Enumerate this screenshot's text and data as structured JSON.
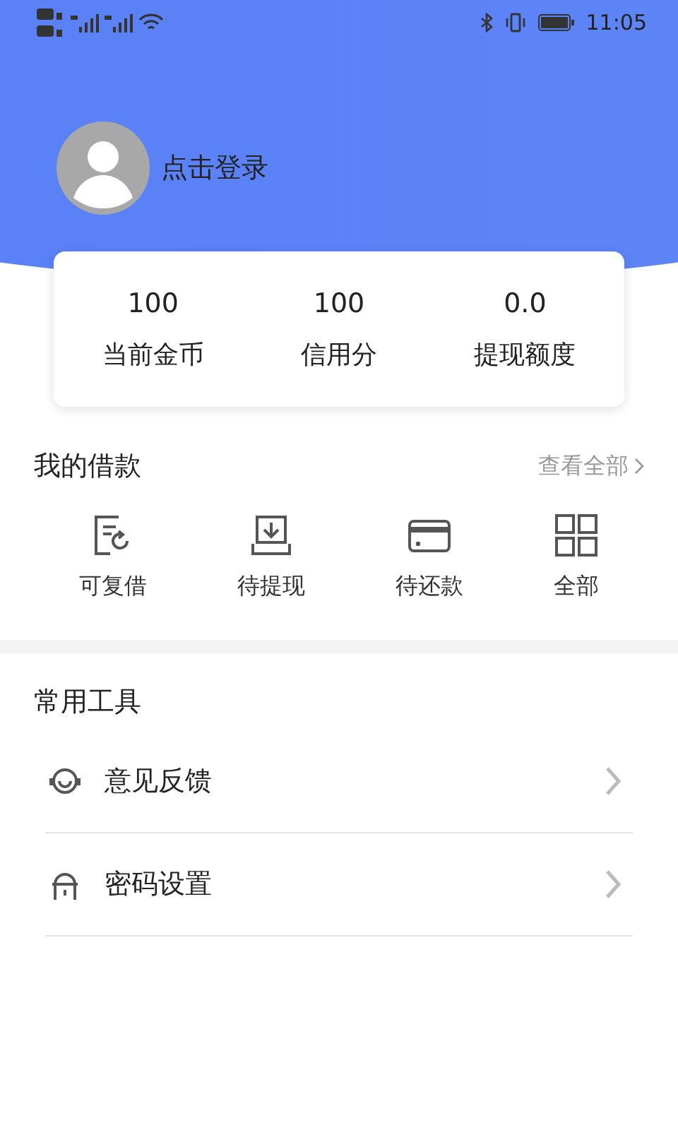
{
  "status_bar": {
    "time": "11:05"
  },
  "profile": {
    "login_label": "点击登录"
  },
  "stats": [
    {
      "value": "100",
      "label": "当前金币"
    },
    {
      "value": "100",
      "label": "信用分"
    },
    {
      "value": "0.0",
      "label": "提现额度"
    }
  ],
  "loans": {
    "title": "我的借款",
    "view_all": "查看全部",
    "items": [
      {
        "kind": "reborrow",
        "label": "可复借"
      },
      {
        "kind": "withdraw",
        "label": "待提现"
      },
      {
        "kind": "repay",
        "label": "待还款"
      },
      {
        "kind": "all",
        "label": "全部"
      }
    ]
  },
  "tools": {
    "title": "常用工具",
    "items": [
      {
        "kind": "feedback",
        "label": "意见反馈"
      },
      {
        "kind": "password",
        "label": "密码设置"
      }
    ]
  }
}
